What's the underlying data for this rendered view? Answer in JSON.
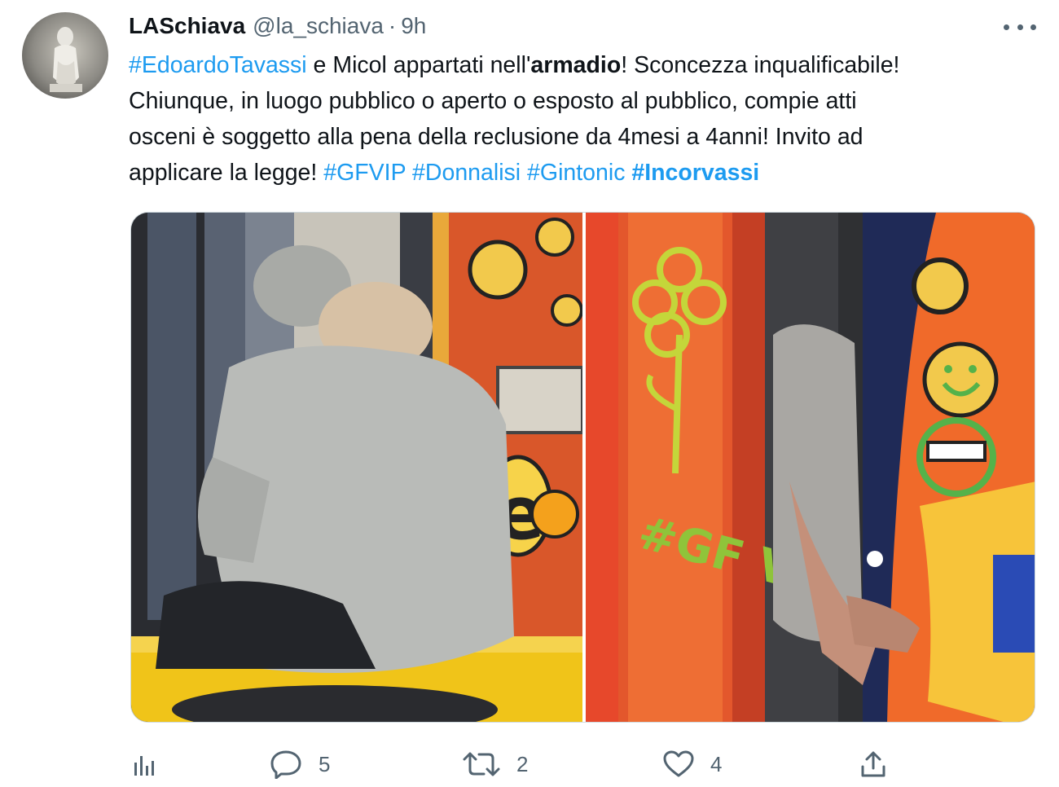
{
  "tweet": {
    "author_name": "LASchiava",
    "author_handle": "@la_schiava",
    "separator": "·",
    "time": "9h",
    "text": {
      "l1_tag": "#EdoardoTavassi",
      "l1_a": " e Micol appartati nell'",
      "l1_bold": "armadio",
      "l1_b": "! Sconcezza inqualificabile!",
      "l2": "Chiunque, in luogo pubblico o aperto o esposto al pubblico, compie atti",
      "l3": "osceni è soggetto alla pena della reclusione da 4mesi a 4anni! Invito ad",
      "l4_a": "applicare la legge! ",
      "l4_tag1": "#GFVIP",
      "l4_tag2": "#Donnalisi",
      "l4_tag3": "#Gintonic",
      "l4_tag4": "#Incorvassi"
    },
    "media_left_text": "e",
    "media_right_text": "#GF VIP"
  },
  "actions": {
    "analytics_icon": "analytics-icon",
    "reply_icon": "reply-icon",
    "reply_count": "5",
    "retweet_icon": "retweet-icon",
    "retweet_count": "2",
    "like_icon": "heart-icon",
    "like_count": "4",
    "share_icon": "share-icon"
  },
  "colors": {
    "link": "#1d9bf0",
    "secondary": "#536471",
    "text": "#0f1419"
  }
}
